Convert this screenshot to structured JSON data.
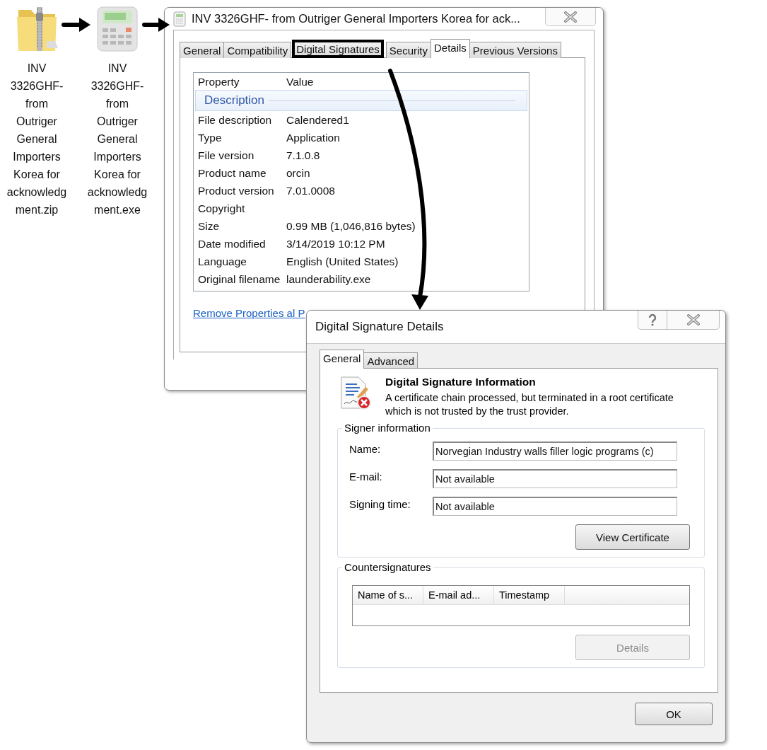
{
  "desktop_icons": [
    {
      "kind": "zip",
      "label": "INV 3326GHF- from Outriger General Importers Korea for acknowledgment.zip"
    },
    {
      "kind": "exe",
      "label": "INV 3326GHF- from Outriger General Importers Korea for acknowledgment.exe"
    }
  ],
  "properties_window": {
    "title": "INV 3326GHF- from Outriger General Importers Korea for ack...",
    "tabs": [
      {
        "label": "General",
        "selected": false,
        "highlighted": false
      },
      {
        "label": "Compatibility",
        "selected": false,
        "highlighted": false
      },
      {
        "label": "Digital Signatures",
        "selected": false,
        "highlighted": true
      },
      {
        "label": "Security",
        "selected": false,
        "highlighted": false
      },
      {
        "label": "Details",
        "selected": true,
        "highlighted": false
      },
      {
        "label": "Previous Versions",
        "selected": false,
        "highlighted": false
      }
    ],
    "table": {
      "columns": [
        "Property",
        "Value"
      ],
      "group": "Description",
      "rows": [
        {
          "property": "File description",
          "value": "Calendered1"
        },
        {
          "property": "Type",
          "value": "Application"
        },
        {
          "property": "File version",
          "value": "7.1.0.8"
        },
        {
          "property": "Product name",
          "value": "orcin"
        },
        {
          "property": "Product version",
          "value": "7.01.0008"
        },
        {
          "property": "Copyright"
        },
        {
          "property": "Size",
          "value": "0.99 MB (1,046,816 bytes)"
        },
        {
          "property": "Date modified",
          "value": "3/14/2019 10:12 PM"
        },
        {
          "property": "Language",
          "value": "English (United States)"
        },
        {
          "property": "Original filename",
          "value": "launderability.exe"
        }
      ]
    },
    "link": "Remove Properties al P"
  },
  "signature_dialog": {
    "title": "Digital Signature Details",
    "tabs": [
      {
        "label": "General",
        "selected": true
      },
      {
        "label": "Advanced",
        "selected": false
      }
    ],
    "heading": "Digital Signature Information",
    "message": "A certificate chain processed, but terminated in a root certificate which is not trusted by the trust provider.",
    "signer_information": {
      "title": "Signer information",
      "fields": [
        {
          "label": "Name:",
          "value": "Norvegian Industry walls filler logic programs (c)"
        },
        {
          "label": "E-mail:",
          "value": "Not available"
        },
        {
          "label": "Signing time:",
          "value": "Not available"
        }
      ],
      "button": {
        "label": "View Certificate",
        "disabled": false
      }
    },
    "countersignatures": {
      "title": "Countersignatures",
      "columns": [
        "Name of s...",
        "E-mail ad...",
        "Timestamp"
      ],
      "button": {
        "label": "Details",
        "disabled": true
      }
    },
    "ok_button": {
      "label": "OK",
      "disabled": false
    }
  }
}
